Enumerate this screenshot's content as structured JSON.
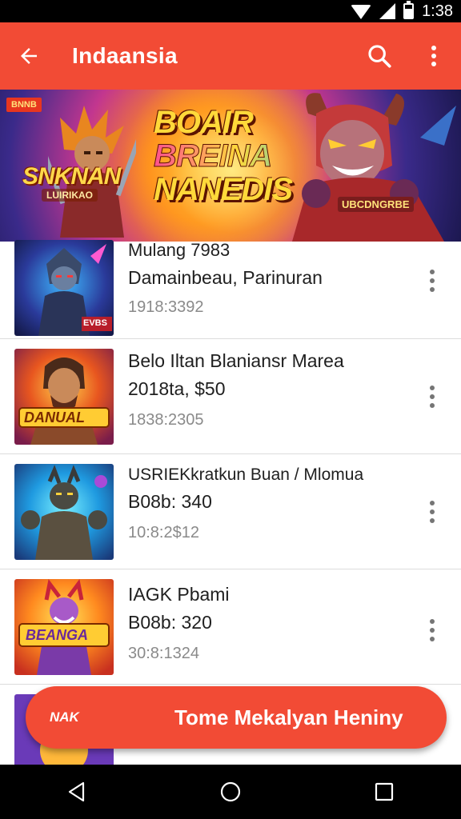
{
  "status_bar": {
    "time": "1:38"
  },
  "app_bar": {
    "title": "Indaansia"
  },
  "banner": {
    "badge": "BNNB",
    "left_title": "SNKNAN",
    "left_subtitle": "LUIRIKAO",
    "main_lines": [
      "BOAIR",
      "BREINA",
      "NANEDIS"
    ],
    "right_tag": "UBCDNGRBE"
  },
  "list": {
    "items": [
      {
        "title": "Mulang 7983",
        "subtitle": "Damainbeau, Parinuran",
        "meta": "1918:3392",
        "thumb_tag": "EVBS"
      },
      {
        "title": "Belo Iltan Blaniansr Marea",
        "subtitle": "2018ta, $50",
        "meta": "1838:2305",
        "thumb_tag": "DANUAL"
      },
      {
        "title": "USRIEKkratkun Buan / Mlomua",
        "subtitle": "B08b: 340",
        "meta": "10:8:2$12",
        "thumb_tag": ""
      },
      {
        "title": "IAGK Pbami",
        "subtitle": "B08b: 320",
        "meta": "30:8:1324",
        "thumb_tag": "BEANGA"
      }
    ]
  },
  "fab": {
    "left_text": "NAK",
    "label": "Tome Mekalyan Heniny"
  },
  "colors": {
    "accent": "#f24b35",
    "text": "#202020",
    "meta": "#8a8a8a"
  },
  "icons": {
    "back": "arrow-left-icon",
    "search": "search-icon",
    "more": "more-vertical-icon"
  }
}
